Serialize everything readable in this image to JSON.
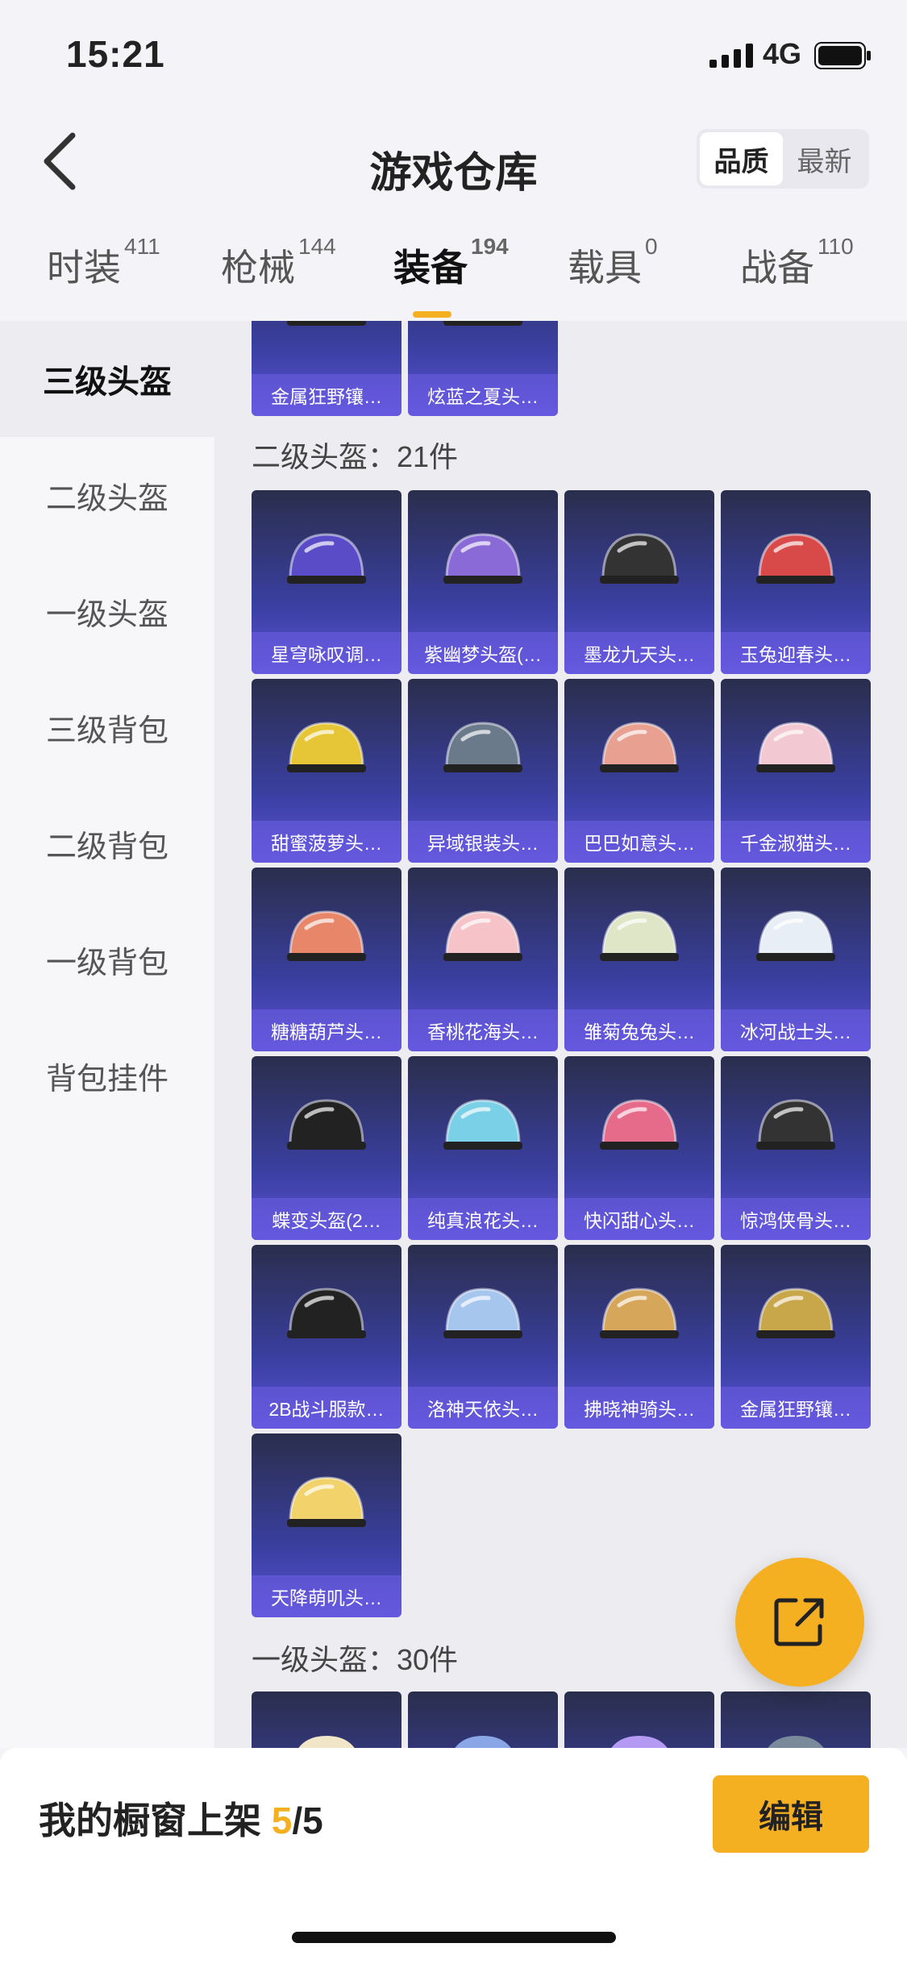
{
  "status_bar": {
    "time": "15:21",
    "network": "4G"
  },
  "header": {
    "title": "游戏仓库",
    "sort_options": [
      "品质",
      "最新"
    ],
    "active_sort": "品质"
  },
  "tabs": [
    {
      "label": "时装",
      "count": "411"
    },
    {
      "label": "枪械",
      "count": "144"
    },
    {
      "label": "装备",
      "count": "194"
    },
    {
      "label": "载具",
      "count": "0"
    },
    {
      "label": "战备",
      "count": "110"
    }
  ],
  "active_tab": "装备",
  "sidebar": [
    {
      "label": "三级头盔"
    },
    {
      "label": "二级头盔"
    },
    {
      "label": "一级头盔"
    },
    {
      "label": "三级背包"
    },
    {
      "label": "二级背包"
    },
    {
      "label": "一级背包"
    },
    {
      "label": "背包挂件"
    }
  ],
  "sections": {
    "top_partial": [
      "金属狂野镶…",
      "炫蓝之夏头…"
    ],
    "level2_head": "二级头盔：21件",
    "level2_items": [
      "星穹咏叹调…",
      "紫幽梦头盔(…",
      "墨龙九天头…",
      "玉兔迎春头…",
      "甜蜜菠萝头…",
      "异域银装头…",
      "巴巴如意头…",
      "千金淑猫头…",
      "糖糖葫芦头…",
      "香桃花海头…",
      "雏菊兔兔头…",
      "冰河战士头…",
      "蝶变头盔(2…",
      "纯真浪花头…",
      "快闪甜心头…",
      "惊鸿侠骨头…",
      "2B战斗服款…",
      "洛神天依头…",
      "拂晓神骑头…",
      "金属狂野镶…",
      "天降萌叽头…"
    ],
    "level1_head": "一级头盔：30件"
  },
  "bottom_bar": {
    "label": "我的橱窗上架",
    "count": "5",
    "total": "/5",
    "edit": "编辑"
  },
  "colors": {
    "accent": "#f5b021",
    "card_top": "#2a2e4c",
    "card_bottom": "#5c52d8"
  },
  "icons": [
    "back-arrow-icon",
    "signal-icon",
    "battery-icon",
    "share-icon",
    "helmet-icon"
  ]
}
